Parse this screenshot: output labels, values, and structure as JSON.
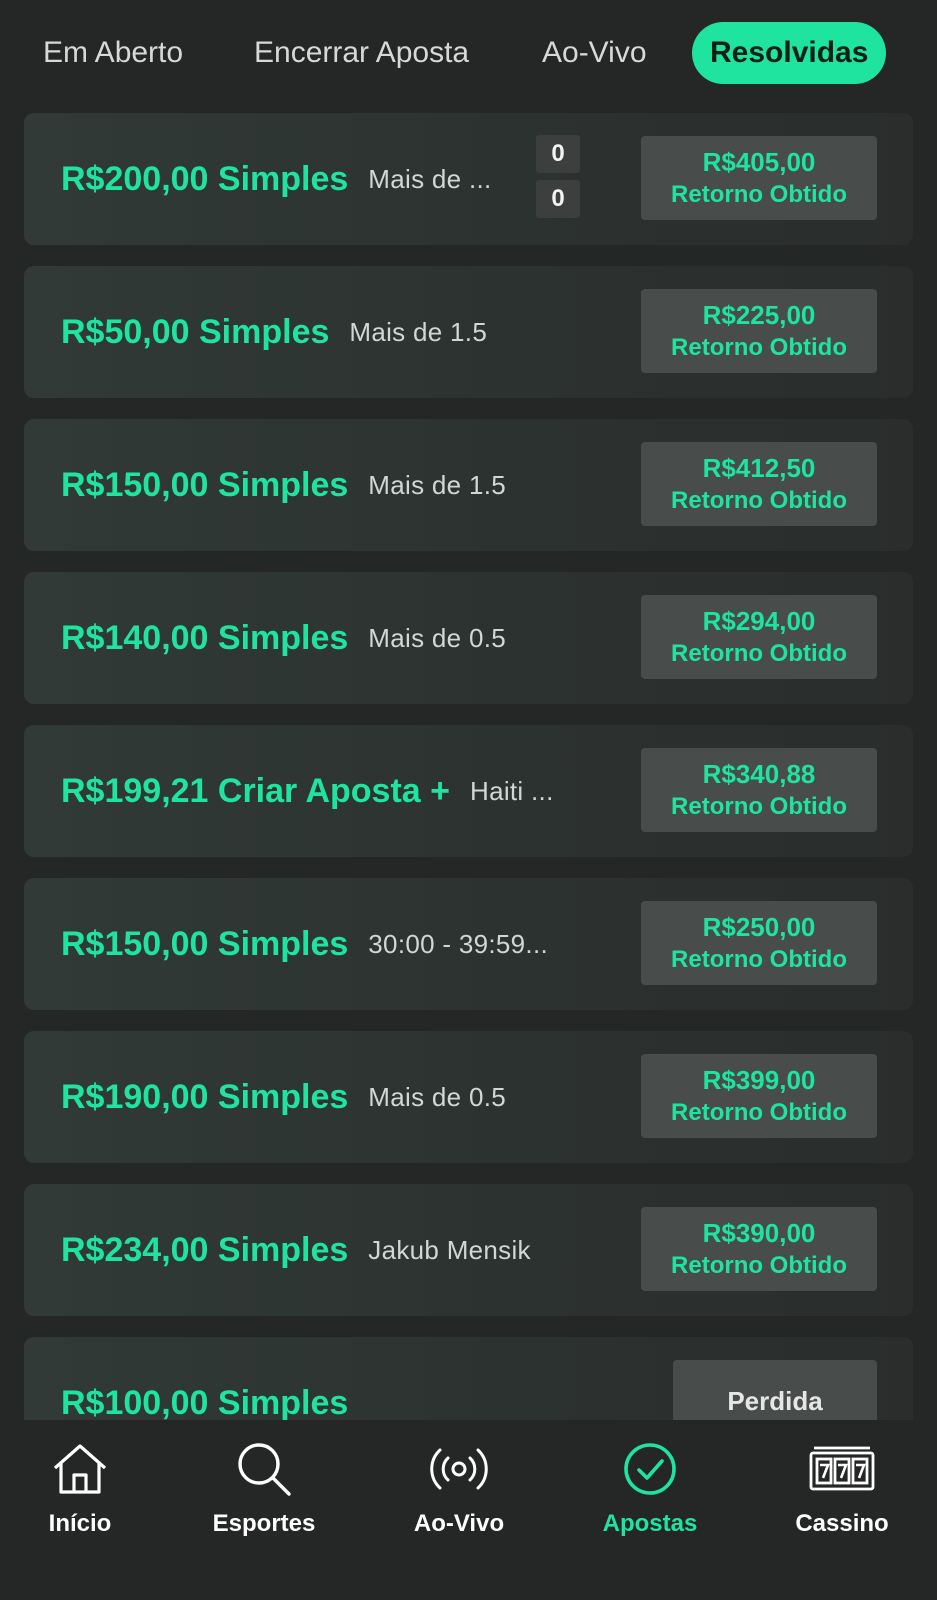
{
  "tabs": [
    {
      "label": "Em Aberto"
    },
    {
      "label": "Encerrar Aposta"
    },
    {
      "label": "Ao-Vivo"
    },
    {
      "label": "Resolvidas",
      "active": true
    }
  ],
  "bets": [
    {
      "stake": "R$200,00 Simples",
      "desc": "Mais de ...",
      "scores": [
        "0",
        "0"
      ],
      "return_amount": "R$405,00",
      "return_label": "Retorno Obtido"
    },
    {
      "stake": "R$50,00 Simples",
      "desc": "Mais de 1.5",
      "return_amount": "R$225,00",
      "return_label": "Retorno Obtido"
    },
    {
      "stake": "R$150,00 Simples",
      "desc": "Mais de 1.5",
      "return_amount": "R$412,50",
      "return_label": "Retorno Obtido"
    },
    {
      "stake": "R$140,00 Simples",
      "desc": "Mais de 0.5",
      "return_amount": "R$294,00",
      "return_label": "Retorno Obtido"
    },
    {
      "stake": "R$199,21 Criar Aposta +",
      "desc": "Haiti ...",
      "return_amount": "R$340,88",
      "return_label": "Retorno Obtido"
    },
    {
      "stake": "R$150,00 Simples",
      "desc": "30:00 - 39:59...",
      "return_amount": "R$250,00",
      "return_label": "Retorno Obtido"
    },
    {
      "stake": "R$190,00 Simples",
      "desc": "Mais de 0.5",
      "return_amount": "R$399,00",
      "return_label": "Retorno Obtido"
    },
    {
      "stake": "R$234,00 Simples",
      "desc": "Jakub Mensik",
      "return_amount": "R$390,00",
      "return_label": "Retorno Obtido"
    },
    {
      "stake": "R$100,00 Simples",
      "desc": "",
      "return_amount": "Perdida",
      "partial": true
    }
  ],
  "nav": [
    {
      "label": "Início",
      "icon": "home-icon"
    },
    {
      "label": "Esportes",
      "icon": "search-icon"
    },
    {
      "label": "Ao-Vivo",
      "icon": "live-broadcast-icon"
    },
    {
      "label": "Apostas",
      "icon": "check-circle-icon",
      "active": true
    },
    {
      "label": "Cassino",
      "icon": "slot-machine-icon"
    }
  ],
  "colors": {
    "accent": "#1fe4a0",
    "background": "#252626",
    "card": "#2e3431",
    "return_box": "#484c4b"
  }
}
